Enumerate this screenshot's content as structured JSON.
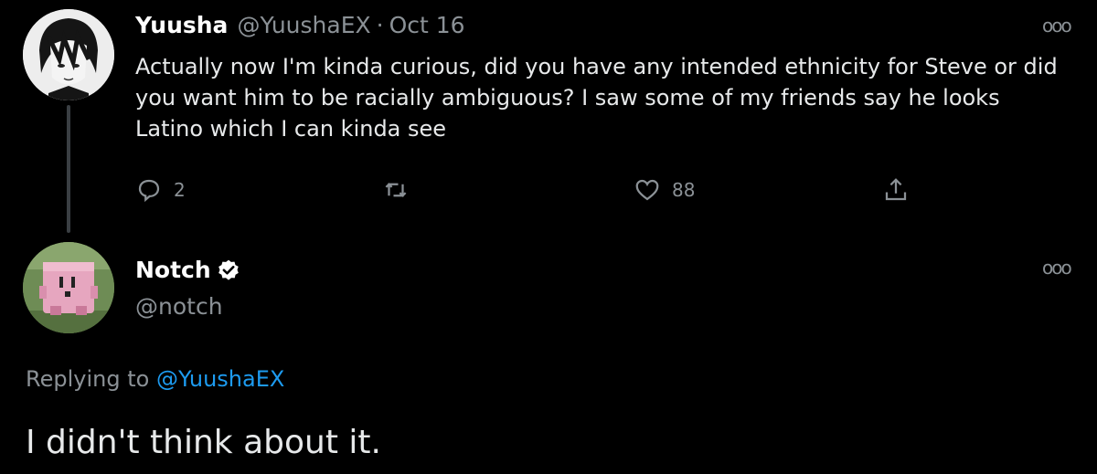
{
  "tweet1": {
    "display_name": "Yuusha",
    "handle": "@YuushaEX",
    "separator": "·",
    "date": "Oct 16",
    "text": "Actually now I'm kinda curious, did you have any intended ethnicity for Steve or did you want him to be racially ambiguous? I saw some of my friends say he looks Latino which I can kinda see",
    "more_glyph": "ooo",
    "actions": {
      "reply_count": "2",
      "like_count": "88"
    }
  },
  "tweet2": {
    "display_name": "Notch",
    "handle": "@notch",
    "verified": true,
    "more_glyph": "ooo",
    "replying_prefix": "Replying to",
    "replying_handle": "@YuushaEX",
    "text": "I didn't think about it."
  },
  "colors": {
    "background": "#000000",
    "muted": "#8b9196",
    "link": "#1d9bf0"
  },
  "icons": [
    "reply-icon",
    "retweet-icon",
    "like-icon",
    "share-icon",
    "verified-badge-icon",
    "more-options-icon"
  ]
}
